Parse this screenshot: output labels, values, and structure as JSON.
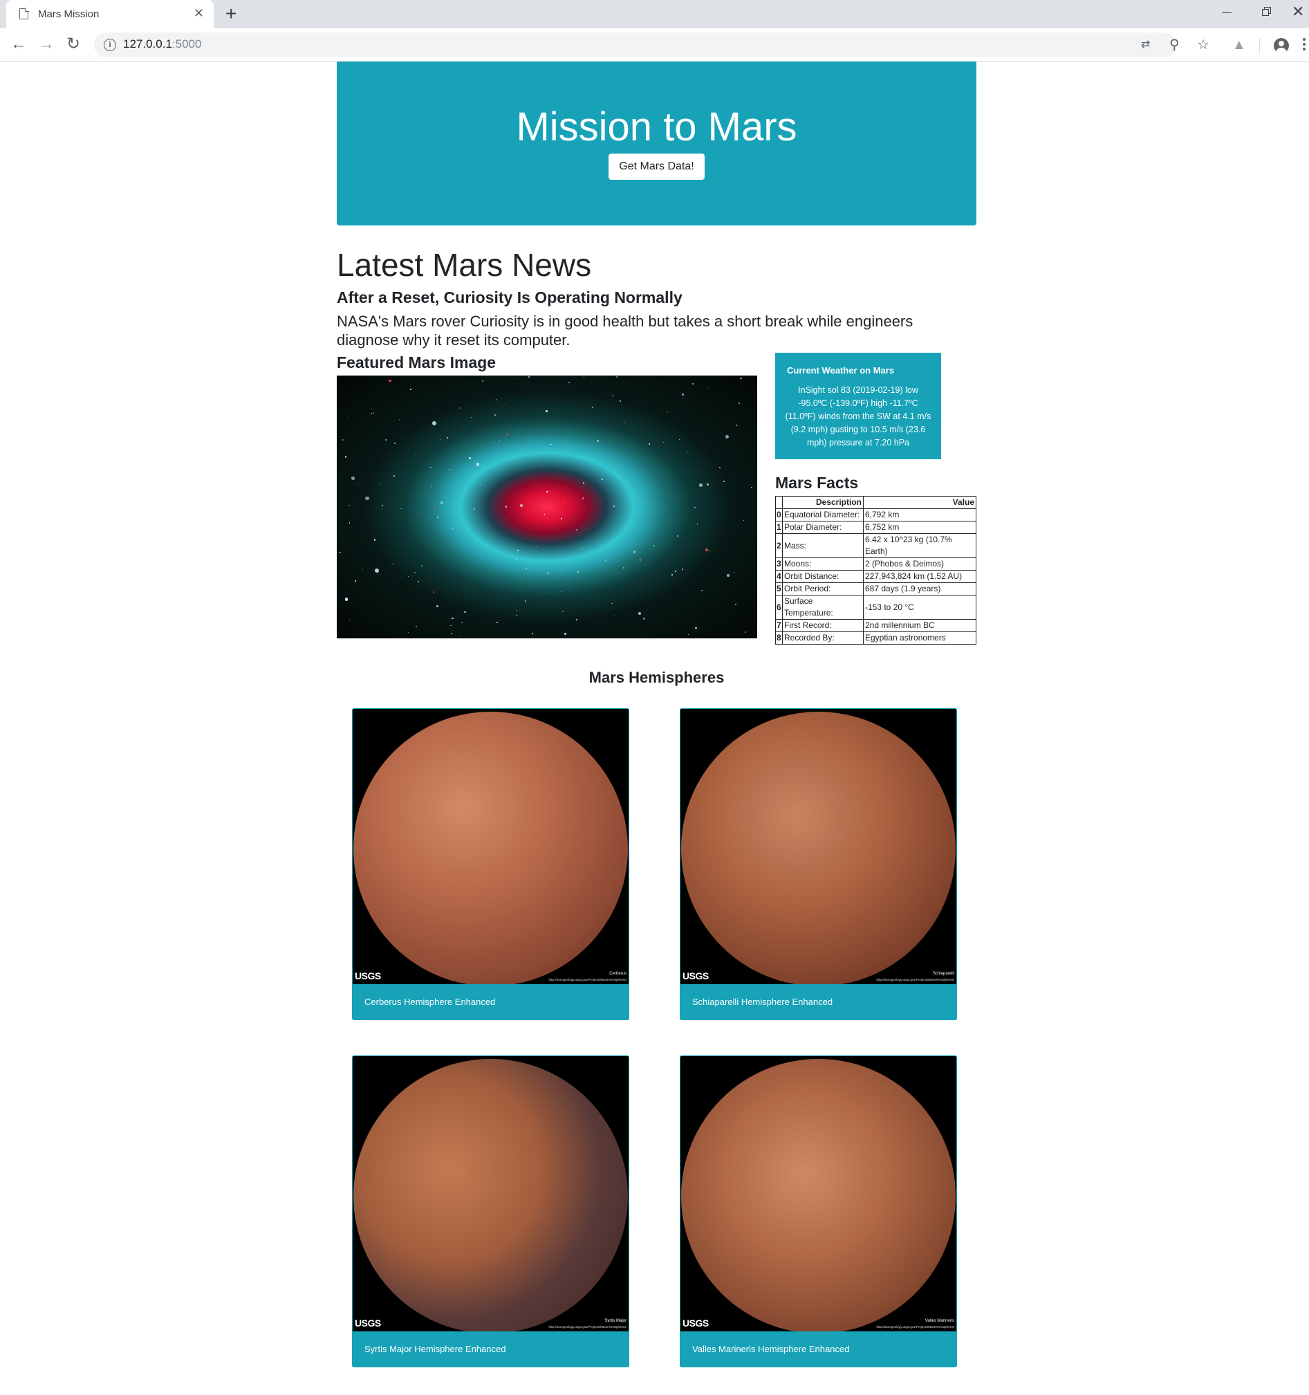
{
  "browser": {
    "tab_title": "Mars Mission",
    "url_host": "127.0.0.1",
    "url_port": ":5000"
  },
  "jumbotron": {
    "title": "Mission to Mars",
    "button_label": "Get Mars Data!"
  },
  "news": {
    "heading": "Latest Mars News",
    "title": "After a Reset, Curiosity Is Operating Normally",
    "paragraph": "NASA's Mars rover Curiosity is in good health but takes a short break while engineers diagnose why it reset its computer."
  },
  "featured": {
    "heading": "Featured Mars Image"
  },
  "weather": {
    "title": "Current Weather on Mars",
    "text": "InSight sol 83 (2019-02-19) low -95.0ºC (-139.0ºF) high -11.7ºC (11.0ºF) winds from the SW at 4.1 m/s (9.2 mph) gusting to 10.5 m/s (23.6 mph) pressure at 7.20 hPa"
  },
  "facts": {
    "heading": "Mars Facts",
    "columns": [
      "",
      "Description",
      "Value"
    ],
    "rows": [
      {
        "idx": "0",
        "desc": "Equatorial Diameter:",
        "val": "6,792 km"
      },
      {
        "idx": "1",
        "desc": "Polar Diameter:",
        "val": "6,752 km"
      },
      {
        "idx": "2",
        "desc": "Mass:",
        "val": "6.42 x 10^23 kg (10.7% Earth)"
      },
      {
        "idx": "3",
        "desc": "Moons:",
        "val": "2 (Phobos & Deimos)"
      },
      {
        "idx": "4",
        "desc": "Orbit Distance:",
        "val": "227,943,824 km (1.52 AU)"
      },
      {
        "idx": "5",
        "desc": "Orbit Period:",
        "val": "687 days (1.9 years)"
      },
      {
        "idx": "6",
        "desc": "Surface Temperature:",
        "val": "-153 to 20 °C"
      },
      {
        "idx": "7",
        "desc": "First Record:",
        "val": "2nd millennium BC"
      },
      {
        "idx": "8",
        "desc": "Recorded By:",
        "val": "Egyptian astronomers"
      }
    ]
  },
  "hemispheres": {
    "heading": "Mars Hemispheres",
    "logo_text": "USGS",
    "source_link": "http://astrogeology.usgs.gov/Projects/MarsHemispheres/",
    "items": [
      {
        "title": "Cerberus Hemisphere Enhanced",
        "caption": "Cerberus"
      },
      {
        "title": "Schiaparelli Hemisphere Enhanced",
        "caption": "Schiaparelli"
      },
      {
        "title": "Syrtis Major Hemisphere Enhanced",
        "caption": "Syrtis Major"
      },
      {
        "title": "Valles Marineris Hemisphere Enhanced",
        "caption": "Valles Marineris"
      }
    ]
  },
  "colors": {
    "accent": "#17a2b8"
  }
}
